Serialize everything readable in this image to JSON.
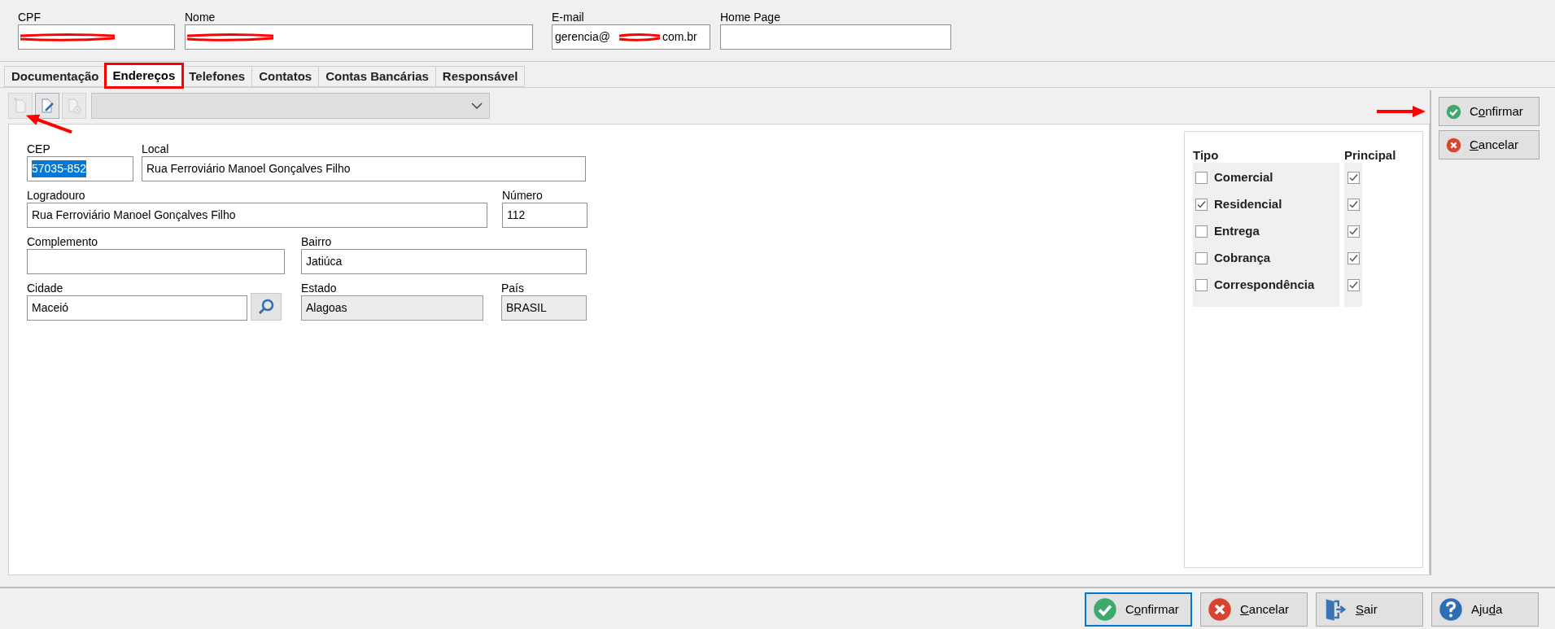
{
  "header_fields": [
    {
      "label": "CPF",
      "redacted": true
    },
    {
      "label": "Nome",
      "redacted": true
    },
    {
      "label": "E-mail",
      "value_start": "gerencia@",
      "value_end": "com.br",
      "redacted": true
    },
    {
      "label": "Home Page",
      "redacted": false
    }
  ],
  "tabs": [
    {
      "label": "Documentação",
      "selected": false,
      "annotated": false
    },
    {
      "label": "Endereços",
      "selected": true,
      "annotated": true
    },
    {
      "label": "Telefones",
      "selected": false,
      "annotated": false
    },
    {
      "label": "Contatos",
      "selected": false,
      "annotated": false
    },
    {
      "label": "Contas Bancárias",
      "selected": false,
      "annotated": false
    },
    {
      "label": "Responsável",
      "selected": false,
      "annotated": false
    }
  ],
  "toolbar": {
    "buttons": [
      {
        "kind": "new",
        "disabled": true,
        "annotated": true
      },
      {
        "kind": "edit",
        "disabled": false,
        "annotated": false
      },
      {
        "kind": "delete",
        "disabled": true,
        "annotated": false
      }
    ],
    "dropdown": {
      "disabled": true
    }
  },
  "address": {
    "cep": {
      "label": "CEP",
      "value": "57035-852",
      "selected": true
    },
    "local": {
      "label": "Local",
      "value": "Rua Ferroviário Manoel Gonçalves Filho"
    },
    "logradouro": {
      "label": "Logradouro",
      "value": "Rua Ferroviário Manoel Gonçalves Filho"
    },
    "numero": {
      "label": "Número",
      "value": "112"
    },
    "complemento": {
      "label": "Complemento"
    },
    "bairro": {
      "label": "Bairro",
      "value": "Jatiúca"
    },
    "cidade": {
      "label": "Cidade",
      "value": "Maceió"
    },
    "estado": {
      "label": "Estado",
      "value": "Alagoas",
      "disabled": true
    },
    "pais": {
      "label": "País",
      "value": "BRASIL",
      "disabled": true
    }
  },
  "types": {
    "tipo_label": "Tipo",
    "principal_label": "Principal",
    "rows": [
      {
        "label": "Comercial",
        "checked": false,
        "principal": true
      },
      {
        "label": "Residencial",
        "checked": true,
        "principal": true
      },
      {
        "label": "Entrega",
        "checked": false,
        "principal": true
      },
      {
        "label": "Cobrança",
        "checked": false,
        "principal": true
      },
      {
        "label": "Correspondência",
        "checked": false,
        "principal": true
      }
    ]
  },
  "side_buttons": [
    {
      "kind": "confirm",
      "label": {
        "before": "C",
        "underlined": "o",
        "after": "nfirmar"
      },
      "annotated": true
    },
    {
      "kind": "cancel",
      "label": {
        "underlined": "C",
        "after": "ancelar"
      },
      "annotated": false
    }
  ],
  "bottom_buttons": [
    {
      "kind": "confirm",
      "label": {
        "before": "C",
        "underlined": "o",
        "after": "nfirmar"
      },
      "focused": true
    },
    {
      "kind": "cancel",
      "label": {
        "underlined": "C",
        "after": "ancelar"
      },
      "focused": false
    },
    {
      "kind": "exit",
      "label": {
        "underlined": "S",
        "after": "air"
      },
      "focused": false
    },
    {
      "kind": "help",
      "label": {
        "before": "Aju",
        "underlined": "d",
        "after": "a"
      },
      "focused": false
    }
  ]
}
